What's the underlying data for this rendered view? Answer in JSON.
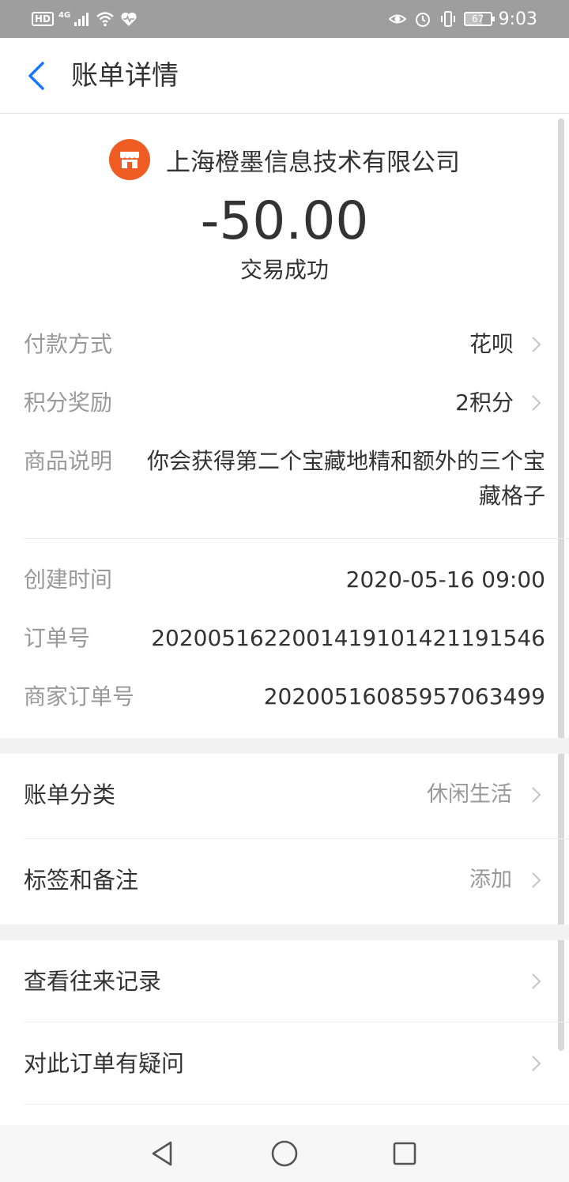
{
  "status_bar": {
    "hd": "HD",
    "network": "4G",
    "battery": "67",
    "time": "9:03"
  },
  "header": {
    "title": "账单详情"
  },
  "merchant": {
    "name": "上海橙墨信息技术有限公司",
    "logo_color": "#ef5d24",
    "icon": "store-icon"
  },
  "transaction": {
    "amount": "-50.00",
    "status": "交易成功"
  },
  "details": {
    "payment_method": {
      "label": "付款方式",
      "value": "花呗"
    },
    "points": {
      "label": "积分奖励",
      "value": "2积分"
    },
    "product": {
      "label": "商品说明",
      "value": "你会获得第二个宝藏地精和额外的三个宝藏格子"
    },
    "created": {
      "label": "创建时间",
      "value": "2020-05-16 09:00"
    },
    "order_no": {
      "label": "订单号",
      "value": "20200516220014191014211915​46"
    },
    "merchant_order_no": {
      "label": "商家订单号",
      "value": "20200516085957063499"
    }
  },
  "actions": {
    "category": {
      "label": "账单分类",
      "value": "休闲生活"
    },
    "tags": {
      "label": "标签和备注",
      "value": "添加"
    },
    "history": {
      "label": "查看往来记录"
    },
    "question": {
      "label": "对此订单有疑问"
    }
  },
  "colors": {
    "accent": "#1677ff",
    "status_bar": "#9e9e9e",
    "label_gray": "#999999",
    "text": "#333333"
  }
}
